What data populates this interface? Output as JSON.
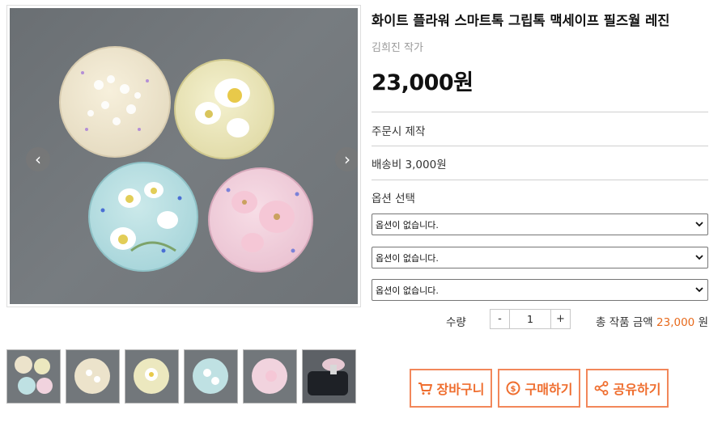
{
  "product": {
    "title": "화이트 플라워 스마트톡 그립톡 맥세이프 필즈월 레진",
    "artist": "김희진 작가",
    "price": "23,000원",
    "made_to_order": "주문시 제작",
    "shipping": "배송비 3,000원",
    "option_heading": "옵션 선택",
    "options": [
      {
        "selected": "옵션이 없습니다."
      },
      {
        "selected": "옵션이 없습니다."
      },
      {
        "selected": "옵션이 없습니다."
      }
    ]
  },
  "quantity": {
    "label": "수량",
    "minus": "-",
    "value": "1",
    "plus": "+"
  },
  "total": {
    "label": "총 작품 금액",
    "amount": "23,000",
    "unit": "원"
  },
  "gallery": {
    "prev_arrow": "‹",
    "next_arrow": "›",
    "thumbnail_count": 6
  },
  "actions": {
    "cart": "장바구니",
    "buy": "구매하기",
    "share": "공유하기"
  },
  "icons": {
    "cart": "cart-icon",
    "buy": "coin-icon",
    "share": "share-icon",
    "select": "chevron-down-icon"
  },
  "colors": {
    "accent": "#ef6e2f",
    "accent_border": "#f2875a",
    "total_amount": "#e76a1c",
    "artist_text": "#999999"
  }
}
